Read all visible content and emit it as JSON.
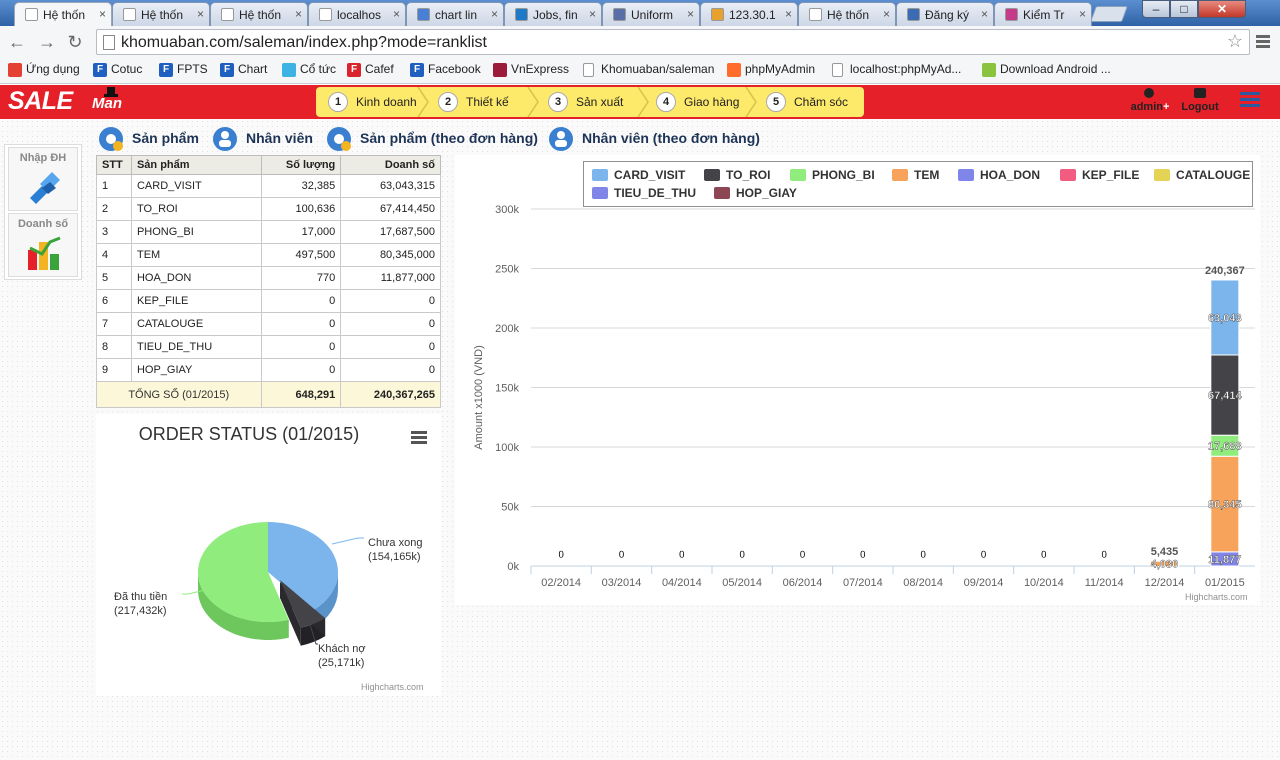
{
  "browser": {
    "tabs": [
      {
        "label": "Hệ thốn",
        "active": true,
        "favicon_color": "#ffffff"
      },
      {
        "label": "Hệ thốn",
        "active": false,
        "favicon_color": "#ffffff"
      },
      {
        "label": "Hệ thốn",
        "active": false,
        "favicon_color": "#ffffff"
      },
      {
        "label": "localhos",
        "active": false,
        "favicon_color": "#ffffff"
      },
      {
        "label": "chart lin",
        "active": false,
        "favicon_color": "#4a7fd6"
      },
      {
        "label": "Jobs, fin",
        "active": false,
        "favicon_color": "#1f79c7"
      },
      {
        "label": "Uniform",
        "active": false,
        "favicon_color": "#5a6fa8"
      },
      {
        "label": "123.30.1",
        "active": false,
        "favicon_color": "#e8a02f"
      },
      {
        "label": "Hệ thốn",
        "active": false,
        "favicon_color": "#ffffff"
      },
      {
        "label": "Đăng ký",
        "active": false,
        "favicon_color": "#3b6bb3"
      },
      {
        "label": "Kiểm Tr",
        "active": false,
        "favicon_color": "#c53b8a"
      }
    ],
    "tab_close": "×",
    "window_controls": {
      "minimize": "–",
      "maximize": "□",
      "close": "✕"
    },
    "url": "khomuaban.com/saleman/index.php?mode=ranklist",
    "bookmarks": [
      {
        "label": "Ứng dụng",
        "icon": "apps-icon",
        "color": "#e34133"
      },
      {
        "label": "Cotuc",
        "icon": "f-icon",
        "color": "#1f5fbf"
      },
      {
        "label": "FPTS",
        "icon": "f-icon",
        "color": "#1f5fbf"
      },
      {
        "label": "Chart",
        "icon": "f-icon",
        "color": "#1f5fbf"
      },
      {
        "label": "Cổ tức",
        "icon": "cb-icon",
        "color": "#3db3e3"
      },
      {
        "label": "Cafef",
        "icon": "f-icon",
        "color": "#d9232d"
      },
      {
        "label": "Facebook",
        "icon": "f-icon",
        "color": "#1f5fbf"
      },
      {
        "label": "VnExpress",
        "icon": "e-icon",
        "color": "#9b1c3a"
      },
      {
        "label": "Khomuaban/saleman",
        "icon": "page-icon",
        "color": "#cccccc"
      },
      {
        "label": "phpMyAdmin",
        "icon": "cpanel-icon",
        "color": "#ff6c2c"
      },
      {
        "label": "localhost:phpMyAd...",
        "icon": "page-icon",
        "color": "#cccccc"
      },
      {
        "label": "Download Android ...",
        "icon": "android-icon",
        "color": "#8ac43f"
      }
    ]
  },
  "app": {
    "logo_sale": "SALE",
    "logo_man": "Man",
    "steps": [
      {
        "num": "1",
        "label": "Kinh doanh"
      },
      {
        "num": "2",
        "label": "Thiết kế"
      },
      {
        "num": "3",
        "label": "Sản xuất"
      },
      {
        "num": "4",
        "label": "Giao hàng"
      },
      {
        "num": "5",
        "label": "Chăm sóc"
      }
    ],
    "user": "admin",
    "user_plus": "+",
    "logout": "Logout",
    "side": [
      {
        "label": "Nhập ĐH",
        "icon": "handshake-icon"
      },
      {
        "label": "Doanh số",
        "icon": "bar-chart-icon"
      }
    ],
    "report_tabs": [
      {
        "label": "Sản phẩm",
        "icon": "products-icon"
      },
      {
        "label": "Nhân viên",
        "icon": "staff-icon"
      },
      {
        "label": "Sản phẩm (theo đơn hàng)",
        "icon": "products-icon"
      },
      {
        "label": "Nhân viên (theo đơn hàng)",
        "icon": "staff-icon"
      }
    ]
  },
  "table": {
    "headers": [
      "STT",
      "Sản phẩm",
      "Số lượng",
      "Doanh số"
    ],
    "rows": [
      [
        "1",
        "CARD_VISIT",
        "32,385",
        "63,043,315"
      ],
      [
        "2",
        "TO_ROI",
        "100,636",
        "67,414,450"
      ],
      [
        "3",
        "PHONG_BI",
        "17,000",
        "17,687,500"
      ],
      [
        "4",
        "TEM",
        "497,500",
        "80,345,000"
      ],
      [
        "5",
        "HOA_DON",
        "770",
        "11,877,000"
      ],
      [
        "6",
        "KEP_FILE",
        "0",
        "0"
      ],
      [
        "7",
        "CATALOUGE",
        "0",
        "0"
      ],
      [
        "8",
        "TIEU_DE_THU",
        "0",
        "0"
      ],
      [
        "9",
        "HOP_GIAY",
        "0",
        "0"
      ]
    ],
    "total": {
      "label": "TỔNG SỐ (01/2015)",
      "quantity": "648,291",
      "revenue": "240,367,265"
    }
  },
  "chart_data": [
    {
      "type": "pie",
      "title": "ORDER STATUS (01/2015)",
      "credit": "Highcharts.com",
      "slices": [
        {
          "name": "Chưa xong",
          "label": "(154,165k)",
          "value": 154165,
          "color": "#7cb5ec"
        },
        {
          "name": "Khách nợ",
          "label": "(25,171k)",
          "value": 25171,
          "color": "#434348"
        },
        {
          "name": "Đã thu tiền",
          "label": "(217,432k)",
          "value": 217432,
          "color": "#90ed7d"
        }
      ]
    },
    {
      "type": "bar",
      "stacked": true,
      "ylabel": "Amount x1000 (VND)",
      "ylim": [
        0,
        300000
      ],
      "yticks": [
        "0k",
        "50k",
        "100k",
        "150k",
        "200k",
        "250k",
        "300k"
      ],
      "categories": [
        "02/2014",
        "03/2014",
        "04/2014",
        "05/2014",
        "06/2014",
        "07/2014",
        "08/2014",
        "09/2014",
        "10/2014",
        "11/2014",
        "12/2014",
        "01/2015"
      ],
      "legend_position": "top-right",
      "credit": "Highcharts.com",
      "series": [
        {
          "name": "CARD_VISIT",
          "color": "#7cb5ec",
          "values": [
            0,
            0,
            0,
            0,
            0,
            0,
            0,
            0,
            0,
            0,
            0,
            63043
          ]
        },
        {
          "name": "TO_ROI",
          "color": "#434348",
          "values": [
            0,
            0,
            0,
            0,
            0,
            0,
            0,
            0,
            0,
            0,
            0,
            67414
          ]
        },
        {
          "name": "PHONG_BI",
          "color": "#90ed7d",
          "values": [
            0,
            0,
            0,
            0,
            0,
            0,
            0,
            0,
            0,
            0,
            0,
            17688
          ]
        },
        {
          "name": "TEM",
          "color": "#f7a35c",
          "values": [
            0,
            0,
            0,
            0,
            0,
            0,
            0,
            0,
            0,
            0,
            4030,
            80345
          ]
        },
        {
          "name": "HOA_DON",
          "color": "#8085e9",
          "values": [
            0,
            0,
            0,
            0,
            0,
            0,
            0,
            0,
            0,
            0,
            0,
            11877
          ]
        },
        {
          "name": "KEP_FILE",
          "color": "#f15c80",
          "values": [
            0,
            0,
            0,
            0,
            0,
            0,
            0,
            0,
            0,
            0,
            0,
            0
          ]
        },
        {
          "name": "CATALOUGE",
          "color": "#e4d354",
          "values": [
            0,
            0,
            0,
            0,
            0,
            0,
            0,
            0,
            0,
            0,
            0,
            0
          ]
        },
        {
          "name": "TIEU_DE_THU",
          "color": "#8085e8",
          "values": [
            0,
            0,
            0,
            0,
            0,
            0,
            0,
            0,
            0,
            0,
            0,
            0
          ]
        },
        {
          "name": "HOP_GIAY",
          "color": "#8d4653",
          "values": [
            0,
            0,
            0,
            0,
            0,
            0,
            0,
            0,
            0,
            0,
            0,
            0
          ]
        }
      ],
      "bar_labels": [
        {
          "category": "01/2015",
          "series": "CARD_VISIT",
          "text": "63,043"
        },
        {
          "category": "01/2015",
          "series": "TO_ROI",
          "text": "67,414"
        },
        {
          "category": "01/2015",
          "series": "PHONG_BI",
          "text": "17,688"
        },
        {
          "category": "01/2015",
          "series": "TEM",
          "text": "80,345"
        },
        {
          "category": "01/2015",
          "series": "HOA_DON",
          "text": "11,877"
        },
        {
          "category": "12/2014",
          "series": "TEM",
          "text": "4,030"
        }
      ],
      "stack_totals": [
        "0",
        "0",
        "0",
        "0",
        "0",
        "0",
        "0",
        "0",
        "0",
        "0",
        "5,435",
        "240,367"
      ]
    }
  ]
}
